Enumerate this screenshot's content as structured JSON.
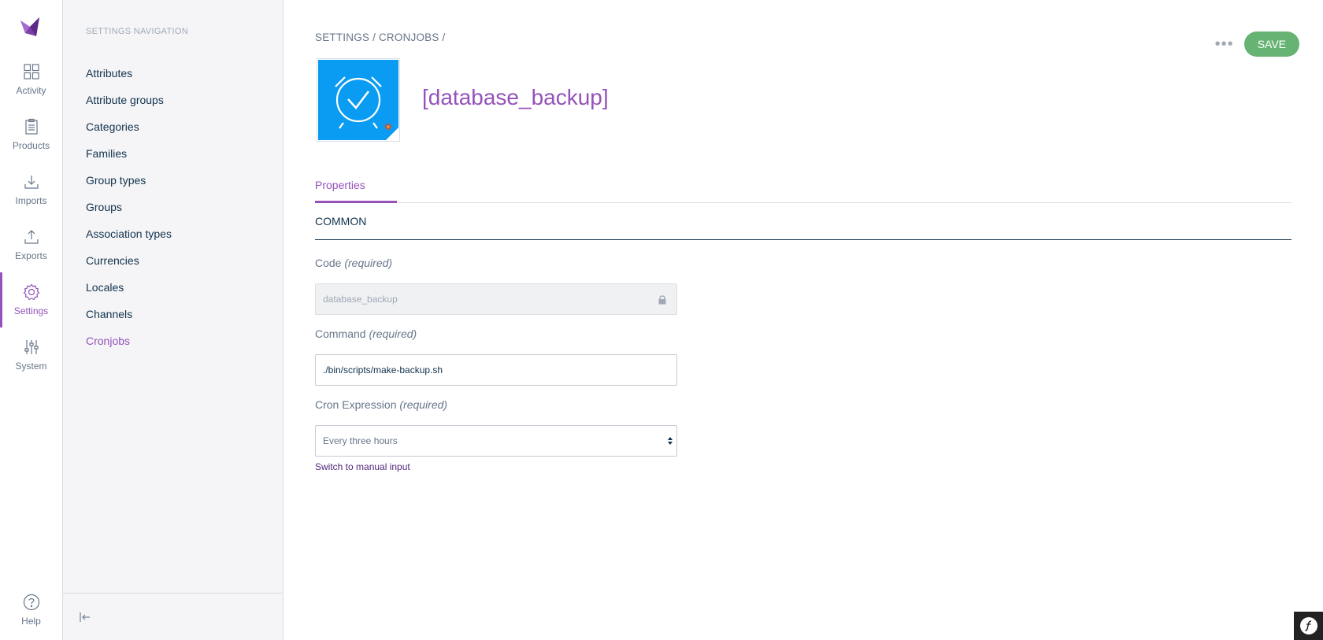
{
  "sidebar": {
    "items": [
      {
        "label": "Activity",
        "icon": "activity-icon"
      },
      {
        "label": "Products",
        "icon": "products-icon"
      },
      {
        "label": "Imports",
        "icon": "imports-icon"
      },
      {
        "label": "Exports",
        "icon": "exports-icon"
      },
      {
        "label": "Settings",
        "icon": "settings-icon"
      },
      {
        "label": "System",
        "icon": "system-icon"
      }
    ],
    "help_label": "Help"
  },
  "settings_nav": {
    "title": "SETTINGS NAVIGATION",
    "items": [
      "Attributes",
      "Attribute groups",
      "Categories",
      "Families",
      "Group types",
      "Groups",
      "Association types",
      "Currencies",
      "Locales",
      "Channels",
      "Cronjobs"
    ],
    "active": "Cronjobs"
  },
  "header": {
    "breadcrumb": [
      "SETTINGS",
      "CRONJOBS"
    ],
    "breadcrumb_separator": "/",
    "more_label": "•••",
    "save_label": "SAVE",
    "title": "[database_backup]"
  },
  "tabs": [
    {
      "label": "Properties",
      "active": true
    }
  ],
  "section": {
    "title": "COMMON"
  },
  "form": {
    "code": {
      "label": "Code",
      "required": "(required)",
      "value": "database_backup",
      "disabled": true
    },
    "command": {
      "label": "Command",
      "required": "(required)",
      "value": "./bin/scripts/make-backup.sh"
    },
    "cron_expression": {
      "label": "Cron Expression",
      "required": "(required)",
      "value": "Every three hours",
      "switch_link": "Switch to manual input"
    }
  },
  "colors": {
    "accent": "#9452ba",
    "save": "#67b373",
    "text": "#11324d",
    "image_bg": "#0a9bf2"
  }
}
